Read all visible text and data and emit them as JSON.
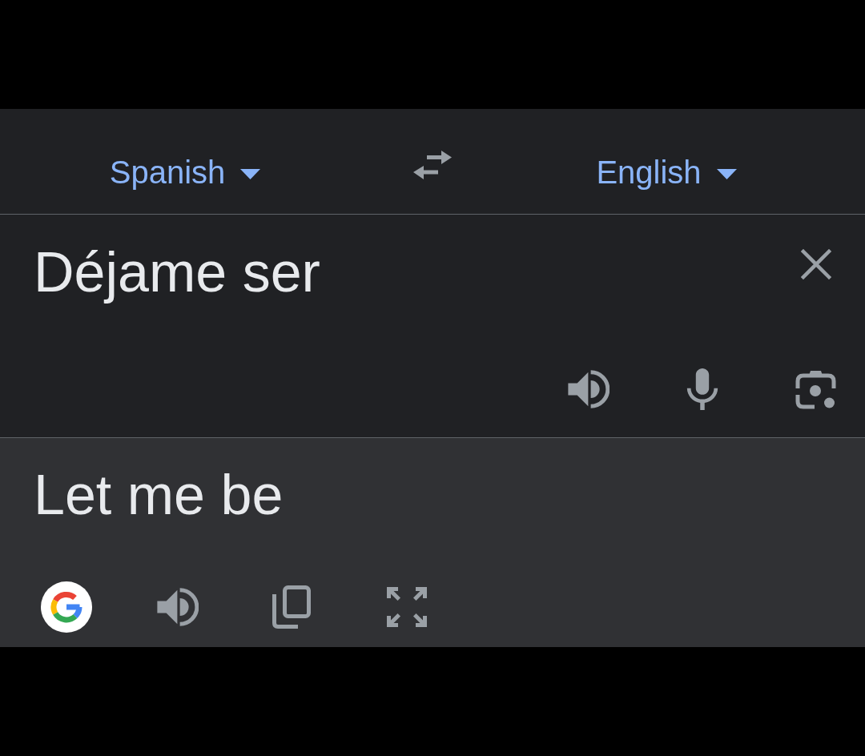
{
  "language_bar": {
    "source_language": {
      "label": "Spanish"
    },
    "target_language": {
      "label": "English"
    }
  },
  "source_panel": {
    "input": {
      "value": "Déjame ser"
    }
  },
  "translation_panel": {
    "text": "Let me be"
  }
}
